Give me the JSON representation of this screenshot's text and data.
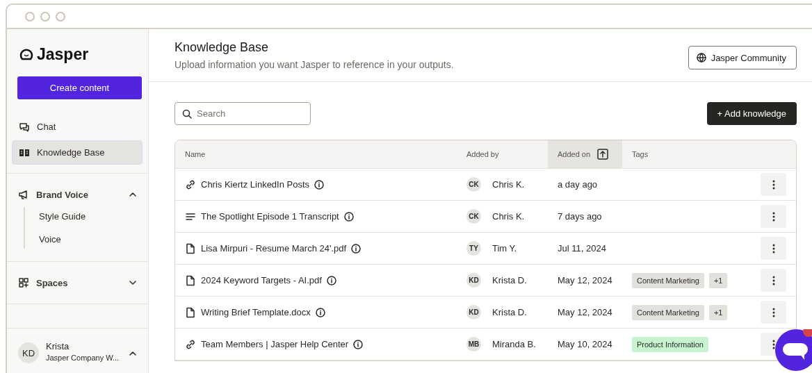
{
  "sidebar": {
    "logo": "Jasper",
    "create_button": "Create content",
    "nav": [
      {
        "label": "Chat",
        "kind": "chat",
        "selected": false
      },
      {
        "label": "Knowledge Base",
        "kind": "book",
        "selected": true
      }
    ],
    "sections": [
      {
        "label": "Brand Voice",
        "kind": "megaphone",
        "expanded": true,
        "children": [
          {
            "label": "Style Guide"
          },
          {
            "label": "Voice"
          }
        ]
      },
      {
        "label": "Spaces",
        "kind": "grid",
        "expanded": false
      }
    ],
    "user": {
      "initials": "KD",
      "name": "Krista",
      "workspace": "Jasper Company W..."
    }
  },
  "header": {
    "title": "Knowledge Base",
    "subtitle": "Upload information you want Jasper to reference in your outputs.",
    "community_button": "Jasper Community"
  },
  "search": {
    "placeholder": "Search"
  },
  "add_button": "+ Add knowledge",
  "table": {
    "columns": [
      {
        "label": "Name",
        "sorted": false
      },
      {
        "label": "Added by",
        "sorted": false
      },
      {
        "label": "Added on",
        "sorted": true
      },
      {
        "label": "Tags",
        "sorted": false
      }
    ],
    "rows": [
      {
        "kind": "link",
        "name": "Chris Kiertz LinkedIn Posts",
        "initials": "CK",
        "added_by": "Chris K.",
        "added_on": "a day ago",
        "tags": []
      },
      {
        "kind": "text",
        "name": "The Spotlight Episode 1 Transcript",
        "initials": "CK",
        "added_by": "Chris K.",
        "added_on": "7 days ago",
        "tags": []
      },
      {
        "kind": "file",
        "name": "Lisa Mirpuri - Resume March 24'.pdf",
        "initials": "TY",
        "added_by": "Tim Y.",
        "added_on": "Jul 11, 2024",
        "tags": []
      },
      {
        "kind": "file",
        "name": "2024 Keyword Targets - AI.pdf",
        "initials": "KD",
        "added_by": "Krista D.",
        "added_on": "May 12, 2024",
        "tags": [
          {
            "label": "Content Marketing",
            "color": "#e3e1dc"
          },
          {
            "label": "+1",
            "color": "#e3e1dc"
          }
        ]
      },
      {
        "kind": "file",
        "name": "Writing Brief Template.docx",
        "initials": "KD",
        "added_by": "Krista D.",
        "added_on": "May 12, 2024",
        "tags": [
          {
            "label": "Content Marketing",
            "color": "#e3e1dc"
          },
          {
            "label": "+1",
            "color": "#e3e1dc"
          }
        ]
      },
      {
        "kind": "link",
        "name": "Team Members | Jasper Help Center",
        "initials": "MB",
        "added_by": "Miranda B.",
        "added_on": "May 10, 2024",
        "tags": [
          {
            "label": "Product Information",
            "color": "#c6f5d0"
          }
        ]
      }
    ]
  }
}
